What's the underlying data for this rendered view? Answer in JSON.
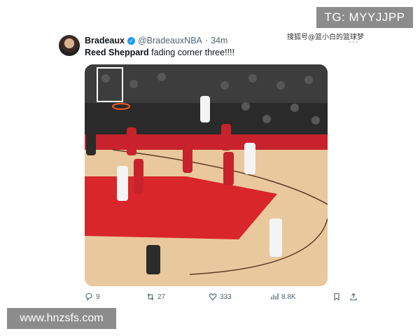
{
  "overlays": {
    "tg_label": "TG: MYYJJPP",
    "watermark_top": "搜狐号@篮小白的篮球梦",
    "site_label": "www.hnzsfs.com"
  },
  "tweet": {
    "author_name": "Bradeaux",
    "handle": "@BradeauxNBA",
    "separator": "·",
    "time": "34m",
    "text_bold": "Reed Sheppard",
    "text_rest": " fading corner three!!!!",
    "verified_icon": "verified-badge-icon",
    "media_alt": "Basketball game clip"
  },
  "actions": {
    "replies": "9",
    "retweets": "27",
    "likes": "333",
    "views": "8.8K"
  },
  "colors": {
    "accent": "#1d9bf0",
    "secondary_text": "#536471",
    "court_wood": "#e9c89d",
    "court_paint": "#d9262b",
    "overlay_gray": "#8c8c8c"
  }
}
